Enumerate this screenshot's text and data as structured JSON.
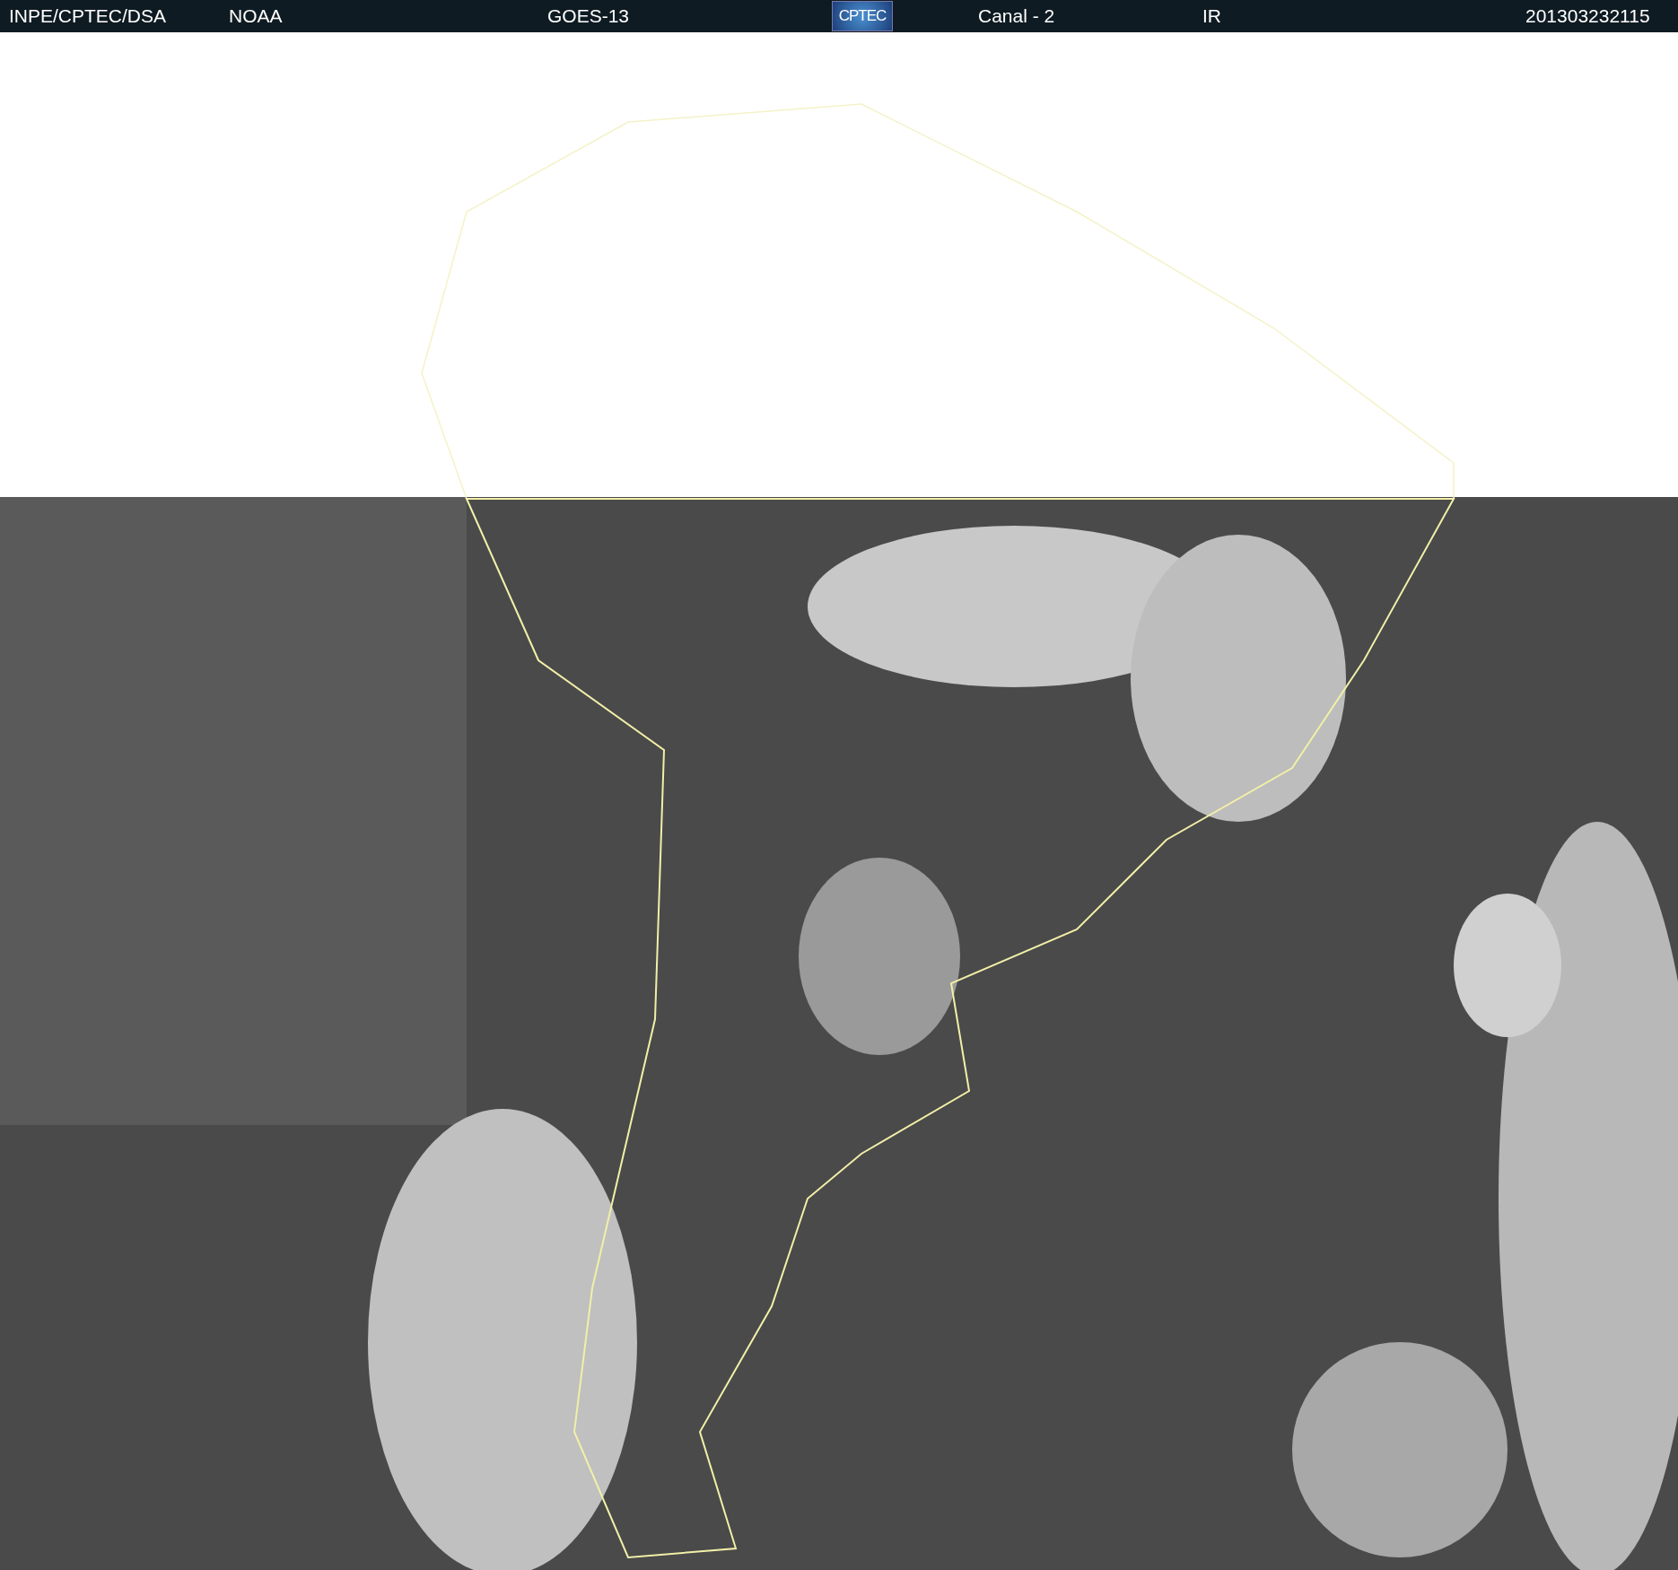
{
  "header": {
    "source": "INPE/CPTEC/DSA",
    "agency": "NOAA",
    "satellite": "GOES-13",
    "logo": "CPTEC",
    "channel": "Canal - 2",
    "band": "IR",
    "timestamp": "201303232115"
  }
}
